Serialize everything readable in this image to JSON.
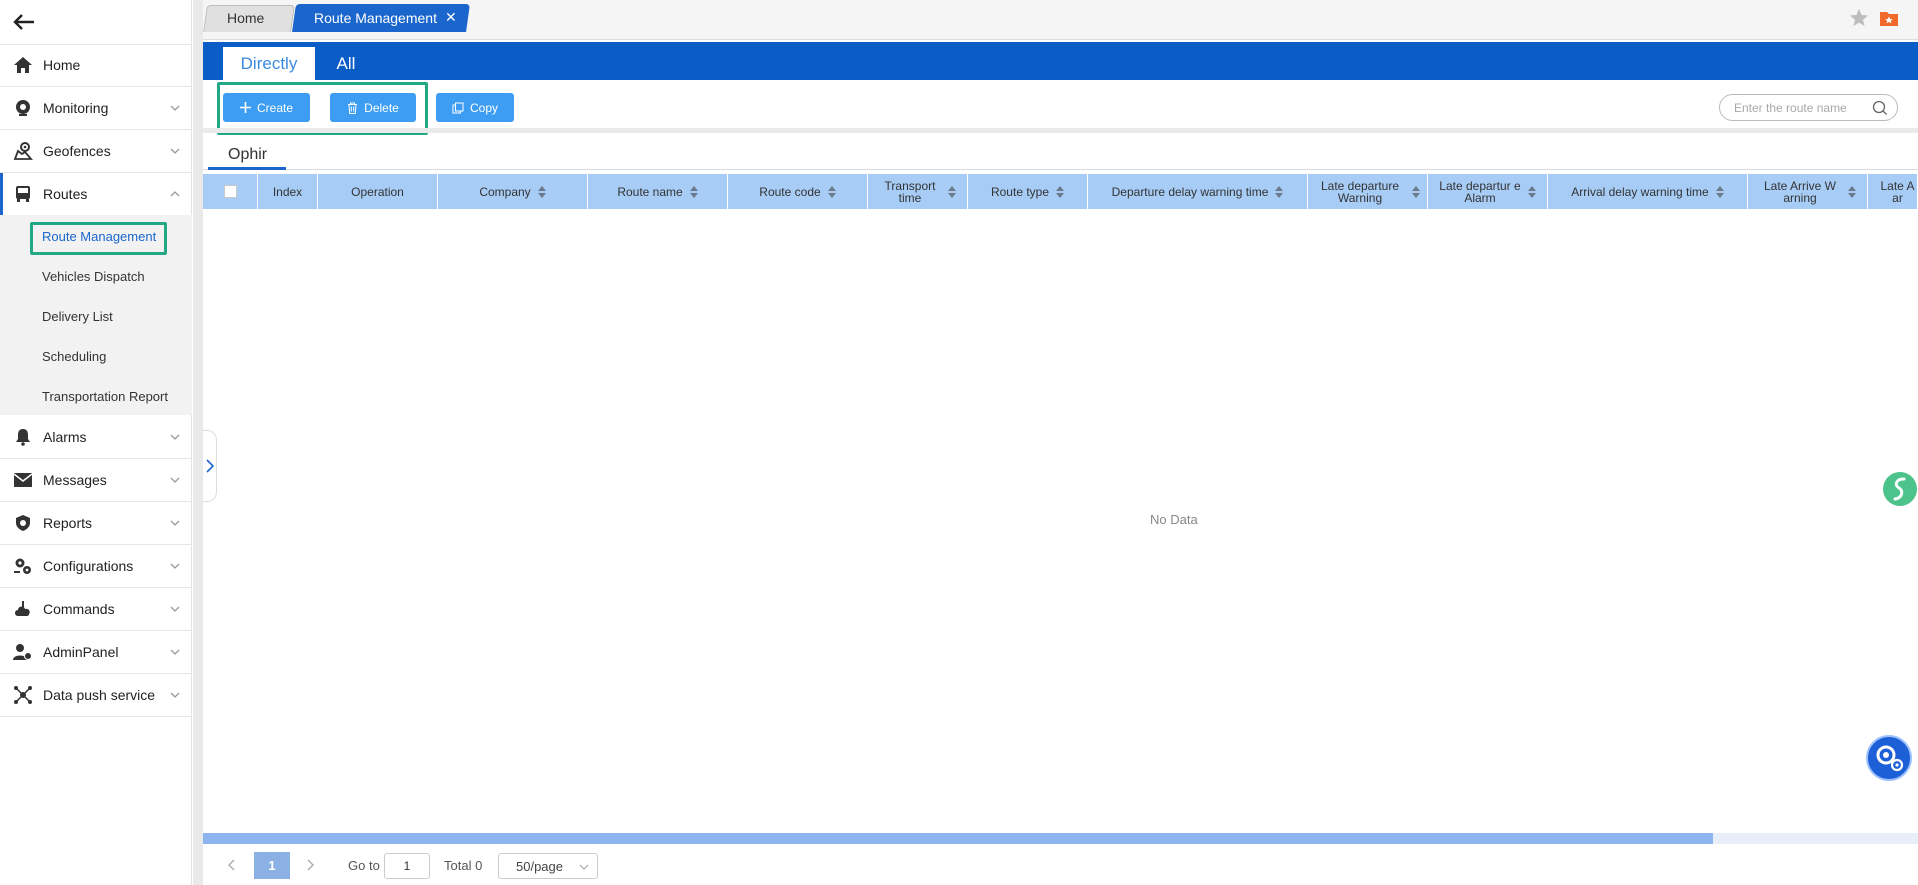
{
  "sidebar": {
    "back_label": "",
    "items": [
      {
        "label": "Home",
        "icon": "home-icon"
      },
      {
        "label": "Monitoring",
        "icon": "camera-icon"
      },
      {
        "label": "Geofences",
        "icon": "geofence-icon"
      },
      {
        "label": "Routes",
        "icon": "bus-icon"
      },
      {
        "label": "Alarms",
        "icon": "bell-icon"
      },
      {
        "label": "Messages",
        "icon": "envelope-icon"
      },
      {
        "label": "Reports",
        "icon": "shield-icon"
      },
      {
        "label": "Configurations",
        "icon": "gears-icon"
      },
      {
        "label": "Commands",
        "icon": "cloud-icon"
      },
      {
        "label": "AdminPanel",
        "icon": "admin-icon"
      },
      {
        "label": "Data push service",
        "icon": "network-icon"
      }
    ],
    "routes_submenu": [
      {
        "label": "Route Management"
      },
      {
        "label": "Vehicles Dispatch"
      },
      {
        "label": "Delivery List"
      },
      {
        "label": "Scheduling"
      },
      {
        "label": "Transportation Report"
      }
    ]
  },
  "tabs": {
    "home": "Home",
    "route_management": "Route Management",
    "close_glyph": "✕"
  },
  "subtabs": {
    "directly": "Directly",
    "all": "All"
  },
  "toolbar": {
    "create": "Create",
    "delete": "Delete",
    "copy": "Copy"
  },
  "search": {
    "placeholder": "Enter the route name",
    "value": ""
  },
  "company_tab": "Ophir",
  "table": {
    "columns": [
      {
        "label": "Index"
      },
      {
        "label": "Operation"
      },
      {
        "label": "Company"
      },
      {
        "label": "Route name"
      },
      {
        "label": "Route code"
      },
      {
        "label": "Transport time"
      },
      {
        "label": "Route type"
      },
      {
        "label": "Departure delay warning time"
      },
      {
        "label": "Late departure Warning"
      },
      {
        "label": "Late departur e Alarm"
      },
      {
        "label": "Arrival delay warning time"
      },
      {
        "label": "Late Arrive W arning"
      },
      {
        "label": "Late A ar"
      }
    ],
    "rows": [],
    "empty_text": "No Data"
  },
  "pagination": {
    "current_page": "1",
    "goto_label": "Go to",
    "goto_value": "1",
    "total": "Total 0",
    "page_size": "50/page"
  },
  "colors": {
    "primary": "#1a66cc",
    "header_bar": "#0a5cc7",
    "button": "#3d9df3",
    "table_header": "#a7cdf6",
    "highlight": "#22a884"
  }
}
